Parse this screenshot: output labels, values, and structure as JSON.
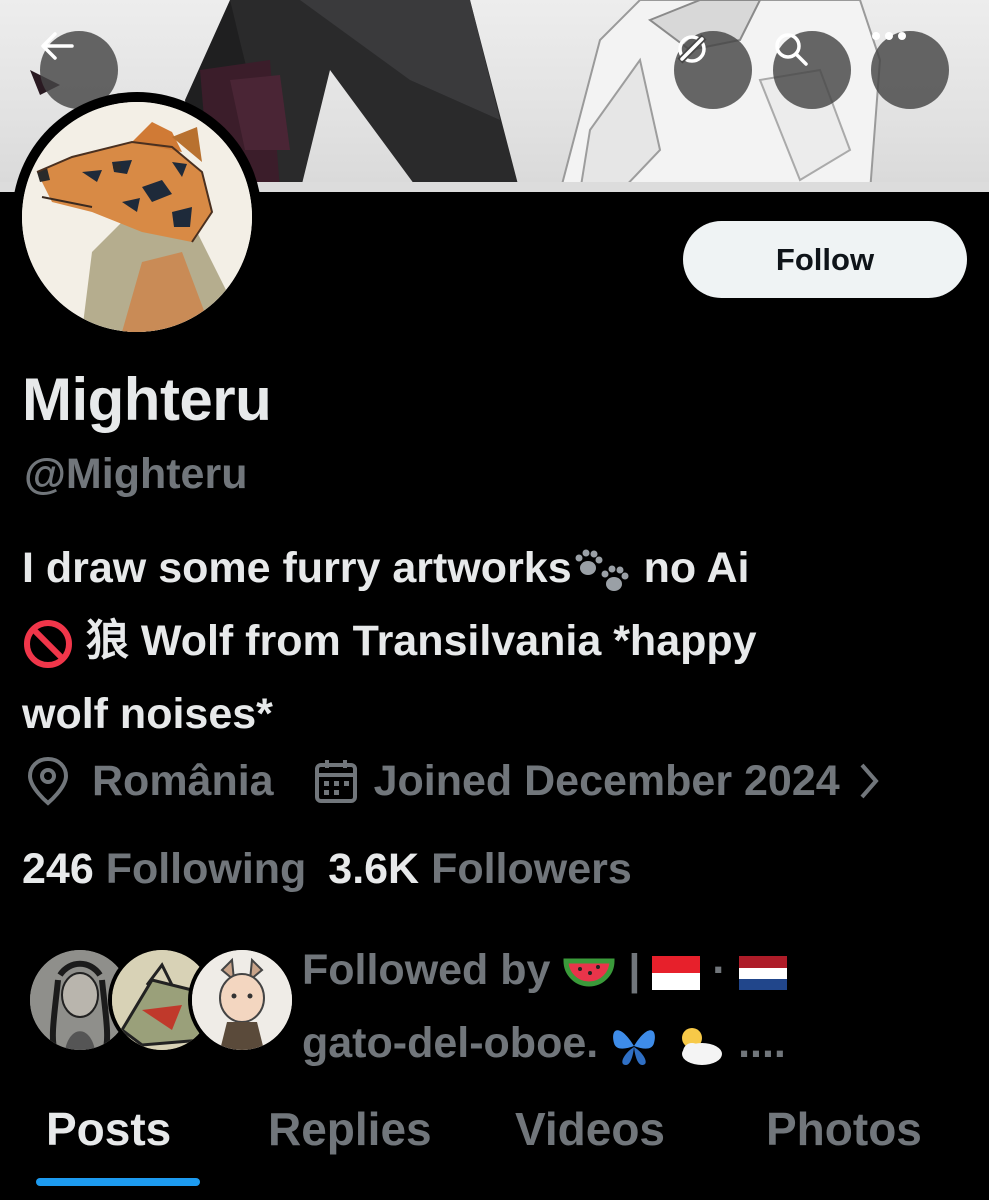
{
  "profile": {
    "display_name": "Mighteru",
    "handle": "@Mighteru",
    "follow_label": "Follow",
    "bio_line1_a": "I draw some furry artworks",
    "bio_line1_b": " no Ai",
    "bio_line2": " 狼 Wolf from Transilvania *happy",
    "bio_line3": "wolf noises*",
    "location": "România",
    "joined": "Joined December 2024",
    "following_count": "246",
    "following_label": "Following",
    "followers_count": "3.6K",
    "followers_label": "Followers",
    "followed_by_line1": "Followed by",
    "followed_by_line2": "gato-del-oboe.",
    "followed_by_ellipsis": "...."
  },
  "tabs": [
    {
      "label": "Posts"
    },
    {
      "label": "Replies"
    },
    {
      "label": "Videos"
    },
    {
      "label": "Photos"
    }
  ],
  "icons": {
    "back": "arrow-left-icon",
    "sync": "sync-icon",
    "search": "search-icon",
    "more": "more-icon",
    "location": "location-pin-icon",
    "calendar": "calendar-icon",
    "chevron": "chevron-right-icon"
  },
  "colors": {
    "background": "#000000",
    "text_primary": "#e7e9ea",
    "text_secondary": "#71767b",
    "accent": "#1d9bf0",
    "follow_bg": "#eff3f4"
  }
}
